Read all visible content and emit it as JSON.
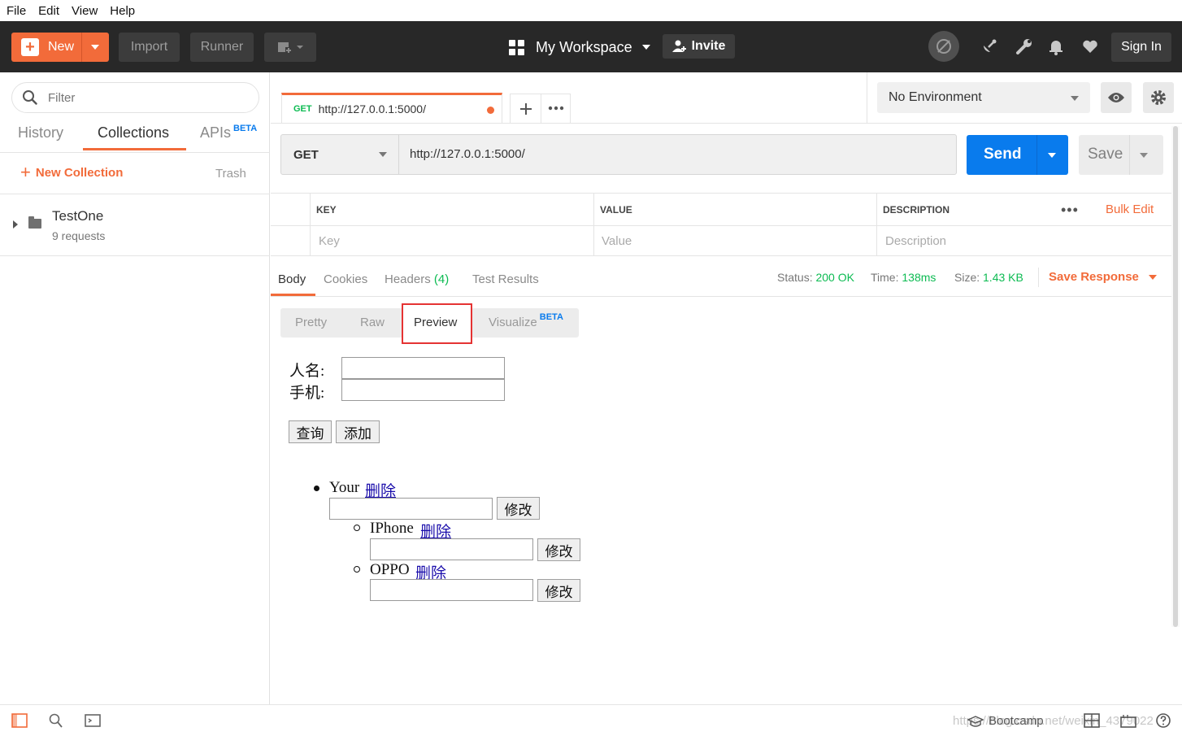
{
  "menu": [
    "File",
    "Edit",
    "View",
    "Help"
  ],
  "header": {
    "new_label": "New",
    "import_label": "Import",
    "runner_label": "Runner",
    "workspace_label": "My Workspace",
    "invite_label": "Invite",
    "signin_label": "Sign In"
  },
  "sidebar": {
    "filter_placeholder": "Filter",
    "tabs": [
      "History",
      "Collections",
      "APIs"
    ],
    "apis_badge": "BETA",
    "new_collection_label": "New Collection",
    "trash_label": "Trash",
    "collections": [
      {
        "name": "TestOne",
        "count": "9 requests"
      }
    ]
  },
  "request": {
    "tab_method": "GET",
    "tab_url": "http://127.0.0.1:5000/",
    "method": "GET",
    "url": "http://127.0.0.1:5000/",
    "send_label": "Send",
    "save_label": "Save"
  },
  "environment": {
    "selected": "No Environment"
  },
  "params": {
    "headers": [
      "KEY",
      "VALUE",
      "DESCRIPTION"
    ],
    "placeholders": [
      "Key",
      "Value",
      "Description"
    ],
    "bulk_edit": "Bulk Edit"
  },
  "response": {
    "tabs": [
      "Body",
      "Cookies",
      "Headers",
      "Test Results"
    ],
    "headers_count": "(4)",
    "status_label": "Status:",
    "status_value": "200 OK",
    "time_label": "Time:",
    "time_value": "138ms",
    "size_label": "Size:",
    "size_value": "1.43 KB",
    "save_response": "Save Response",
    "view_tabs": [
      "Pretty",
      "Raw",
      "Preview",
      "Visualize"
    ],
    "visualize_badge": "BETA"
  },
  "preview": {
    "name_label": "人名:",
    "phone_label": "手机:",
    "query_btn": "查询",
    "add_btn": "添加",
    "items": [
      {
        "name": "Your",
        "delete": "删除",
        "edit": "修改"
      },
      {
        "name": "IPhone",
        "delete": "删除",
        "edit": "修改"
      },
      {
        "name": "OPPO",
        "delete": "删除",
        "edit": "修改"
      }
    ]
  },
  "footer": {
    "bootcamp_label": "Bootcamp",
    "watermark": "https://blog.csdn.net/weixin_4379022"
  },
  "colors": {
    "accent": "#f26b3a",
    "send_blue": "#097bed",
    "success_green": "#0cbb52",
    "header_bg": "#282828"
  }
}
